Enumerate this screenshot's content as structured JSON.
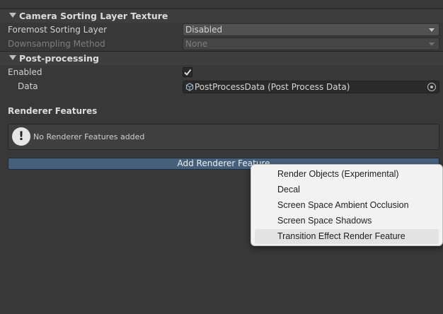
{
  "camera_sorting": {
    "title": "Camera Sorting Layer Texture",
    "foremost_label": "Foremost Sorting Layer",
    "foremost_value": "Disabled",
    "downsampling_label": "Downsampling Method",
    "downsampling_value": "None"
  },
  "post_processing": {
    "title": "Post-processing",
    "enabled_label": "Enabled",
    "enabled_checked": true,
    "data_label": "Data",
    "data_value": "PostProcessData (Post Process Data)"
  },
  "renderer_features": {
    "title": "Renderer Features",
    "empty_message": "No Renderer Features added",
    "add_button_label": "Add Renderer Feature"
  },
  "context_menu": {
    "items": [
      "Render Objects (Experimental)",
      "Decal",
      "Screen Space Ambient Occlusion",
      "Screen Space Shadows",
      "Transition Effect Render Feature"
    ],
    "highlighted_index": 4
  },
  "colors": {
    "panel_bg": "#383838",
    "button_accent": "#46607c",
    "menu_bg": "#f2f2f2"
  }
}
